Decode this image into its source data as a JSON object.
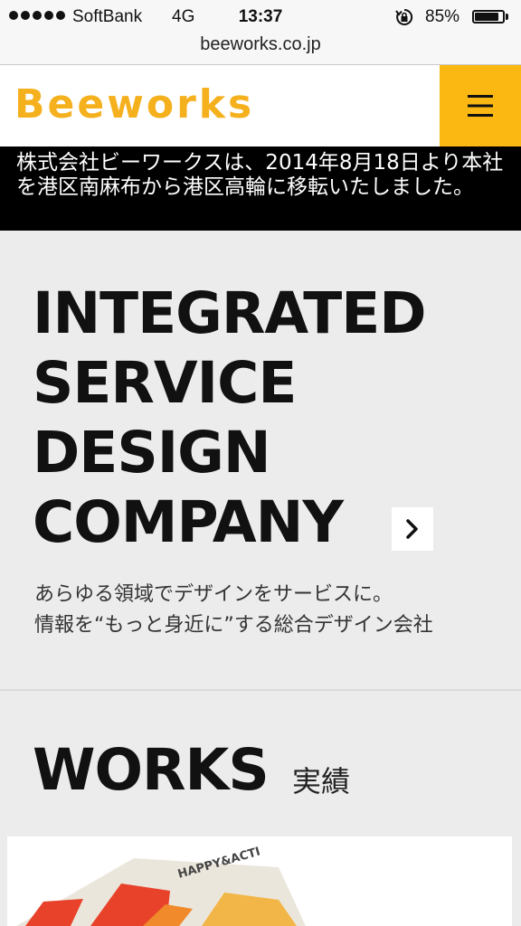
{
  "status_bar": {
    "carrier": "SoftBank",
    "network": "4G",
    "time": "13:37",
    "battery_percent": "85%",
    "battery_level": 0.85
  },
  "browser": {
    "url": "beeworks.co.jp"
  },
  "header": {
    "logo_text": "Beeworks",
    "menu_icon_glyph": "☰",
    "accent_color": "#fbb813"
  },
  "notice": {
    "text": "株式会社ビーワークスは、2014年8月18日より本社を港区南麻布から港区高輪に移転いたしました。"
  },
  "hero": {
    "title_lines": [
      "INTEGRATED",
      "SERVICE",
      "DESIGN",
      "COMPANY"
    ],
    "next_icon_glyph": "›",
    "subtitle_lines": [
      "あらゆる領域でデザインをサービスに。",
      "情報を“もっと身近に”する総合デザイン会社"
    ]
  },
  "works": {
    "title": "WORKS",
    "subtitle": "実績",
    "card_image_text": "HAPPY&ACTI"
  }
}
